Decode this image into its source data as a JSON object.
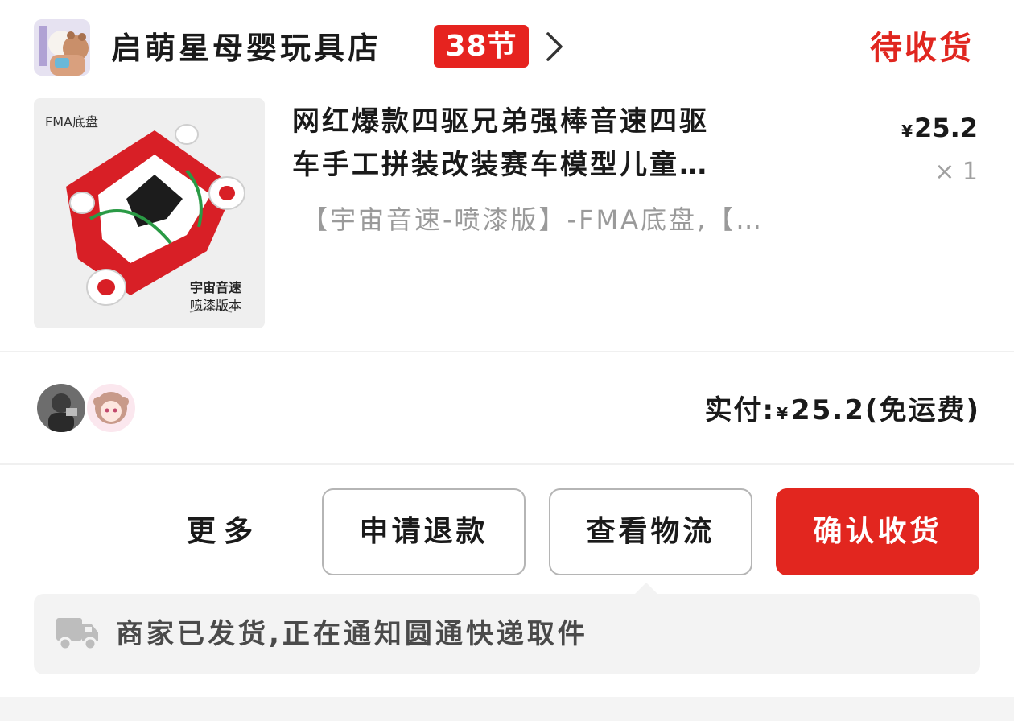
{
  "shop": {
    "name": "启萌星母婴玩具店",
    "promo_badge": "38节",
    "order_status": "待收货"
  },
  "product": {
    "image_tag": "FMA底盘",
    "image_caption_line1": "宇宙音速",
    "image_caption_line2": "喷漆版本",
    "title_line1": "网红爆款四驱兄弟强棒音速四驱",
    "title_line2": "车手工拼装改装赛车模型儿童…",
    "spec": "【宇宙音速-喷漆版】-FMA底盘,【…",
    "price_symbol": "¥",
    "price_value": "25.2",
    "quantity": "× 1"
  },
  "payment": {
    "label": "实付:",
    "symbol": "¥",
    "amount": "25.2",
    "note": "(免运费)"
  },
  "actions": {
    "more": "更多",
    "refund": "申请退款",
    "logistics": "查看物流",
    "confirm": "确认收货"
  },
  "logistics": {
    "message": "商家已发货,正在通知圆通快递取件"
  },
  "colors": {
    "accent": "#e2261f",
    "muted_text": "#9a9a9a",
    "panel_bg": "#f3f3f3"
  },
  "icons": {
    "shop_chevron": "chevron-right-icon",
    "logistics": "truck-icon"
  }
}
